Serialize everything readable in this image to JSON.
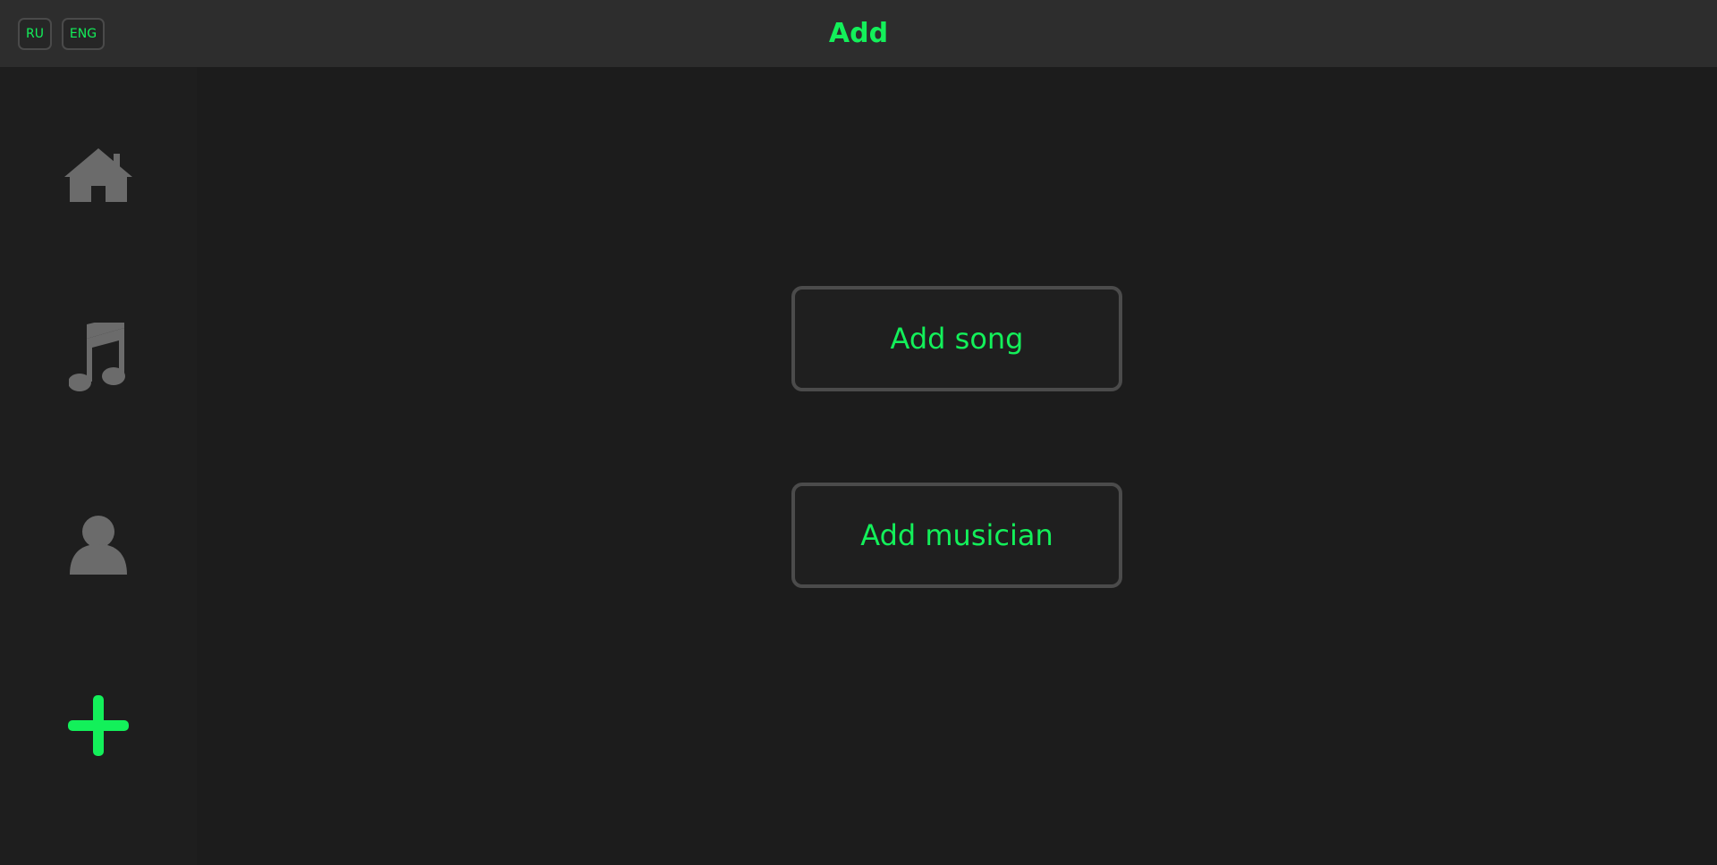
{
  "header": {
    "title": "Add",
    "languages": [
      {
        "label": "RU"
      },
      {
        "label": "ENG"
      }
    ]
  },
  "sidebar": {
    "items": [
      {
        "icon": "home-icon",
        "active": false
      },
      {
        "icon": "music-note-icon",
        "active": false
      },
      {
        "icon": "person-icon",
        "active": false
      },
      {
        "icon": "plus-icon",
        "active": true
      }
    ]
  },
  "main": {
    "add_song_label": "Add song",
    "add_musician_label": "Add musician"
  },
  "colors": {
    "accent": "#13f05a",
    "icon_inactive": "#6b6b6b",
    "header_bg": "#2d2d2d",
    "sidebar_bg": "#1e1e1e",
    "main_bg": "#1c1c1c",
    "border": "#4b4b4b"
  }
}
